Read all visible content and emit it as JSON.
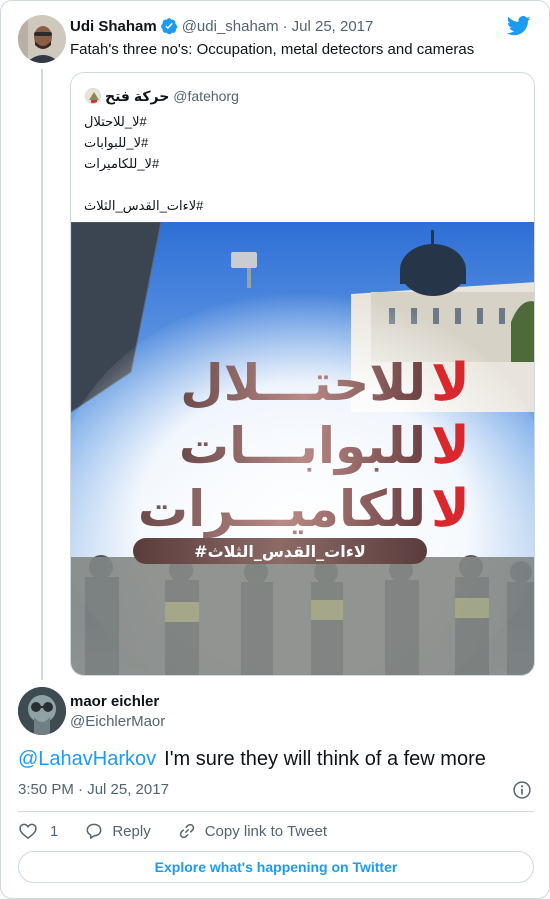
{
  "tweet": {
    "author_name": "Udi Shaham",
    "author_handle": "@udi_shaham",
    "date": "Jul 25, 2017",
    "separator": "·",
    "text": "Fatah's three no's: Occupation, metal detectors and cameras",
    "verified": true
  },
  "quoted": {
    "author_name": "حركة فتح",
    "author_handle": "@fatehorg",
    "lines": [
      "#لا_للاحتلال",
      "#لا_للبوابات",
      "#لا_للكاميرات",
      "",
      "#لاءات_القدس_الثلاث"
    ],
    "image": {
      "line1_prefix": "لا",
      "line1": "للاحتـــلال",
      "line2_prefix": "لا",
      "line2": "للبوابـــات",
      "line3_prefix": "لا",
      "line3": "للكاميـــرات",
      "banner": "#لاءات_القدس_الثلاث"
    }
  },
  "reply": {
    "author_name": "maor eichler",
    "author_handle": "@EichlerMaor",
    "mention": "@LahavHarkov",
    "text": "I'm sure they will think of a few more",
    "timestamp": "3:50 PM · Jul 25, 2017",
    "likes": "1",
    "reply_label": "Reply",
    "copy_link_label": "Copy link to Tweet"
  },
  "footer": {
    "explore_label": "Explore what's happening on Twitter"
  },
  "icons": {
    "verified": "verified-badge-icon",
    "brand": "twitter-bird-icon",
    "info": "info-icon",
    "like": "heart-icon",
    "reply": "speech-bubble-icon",
    "copy": "link-icon"
  },
  "colors": {
    "accent": "#1d9bf0",
    "text": "#0f1419",
    "muted": "#536471",
    "border": "#cfd9de",
    "slogan_red": "#d9272e"
  }
}
